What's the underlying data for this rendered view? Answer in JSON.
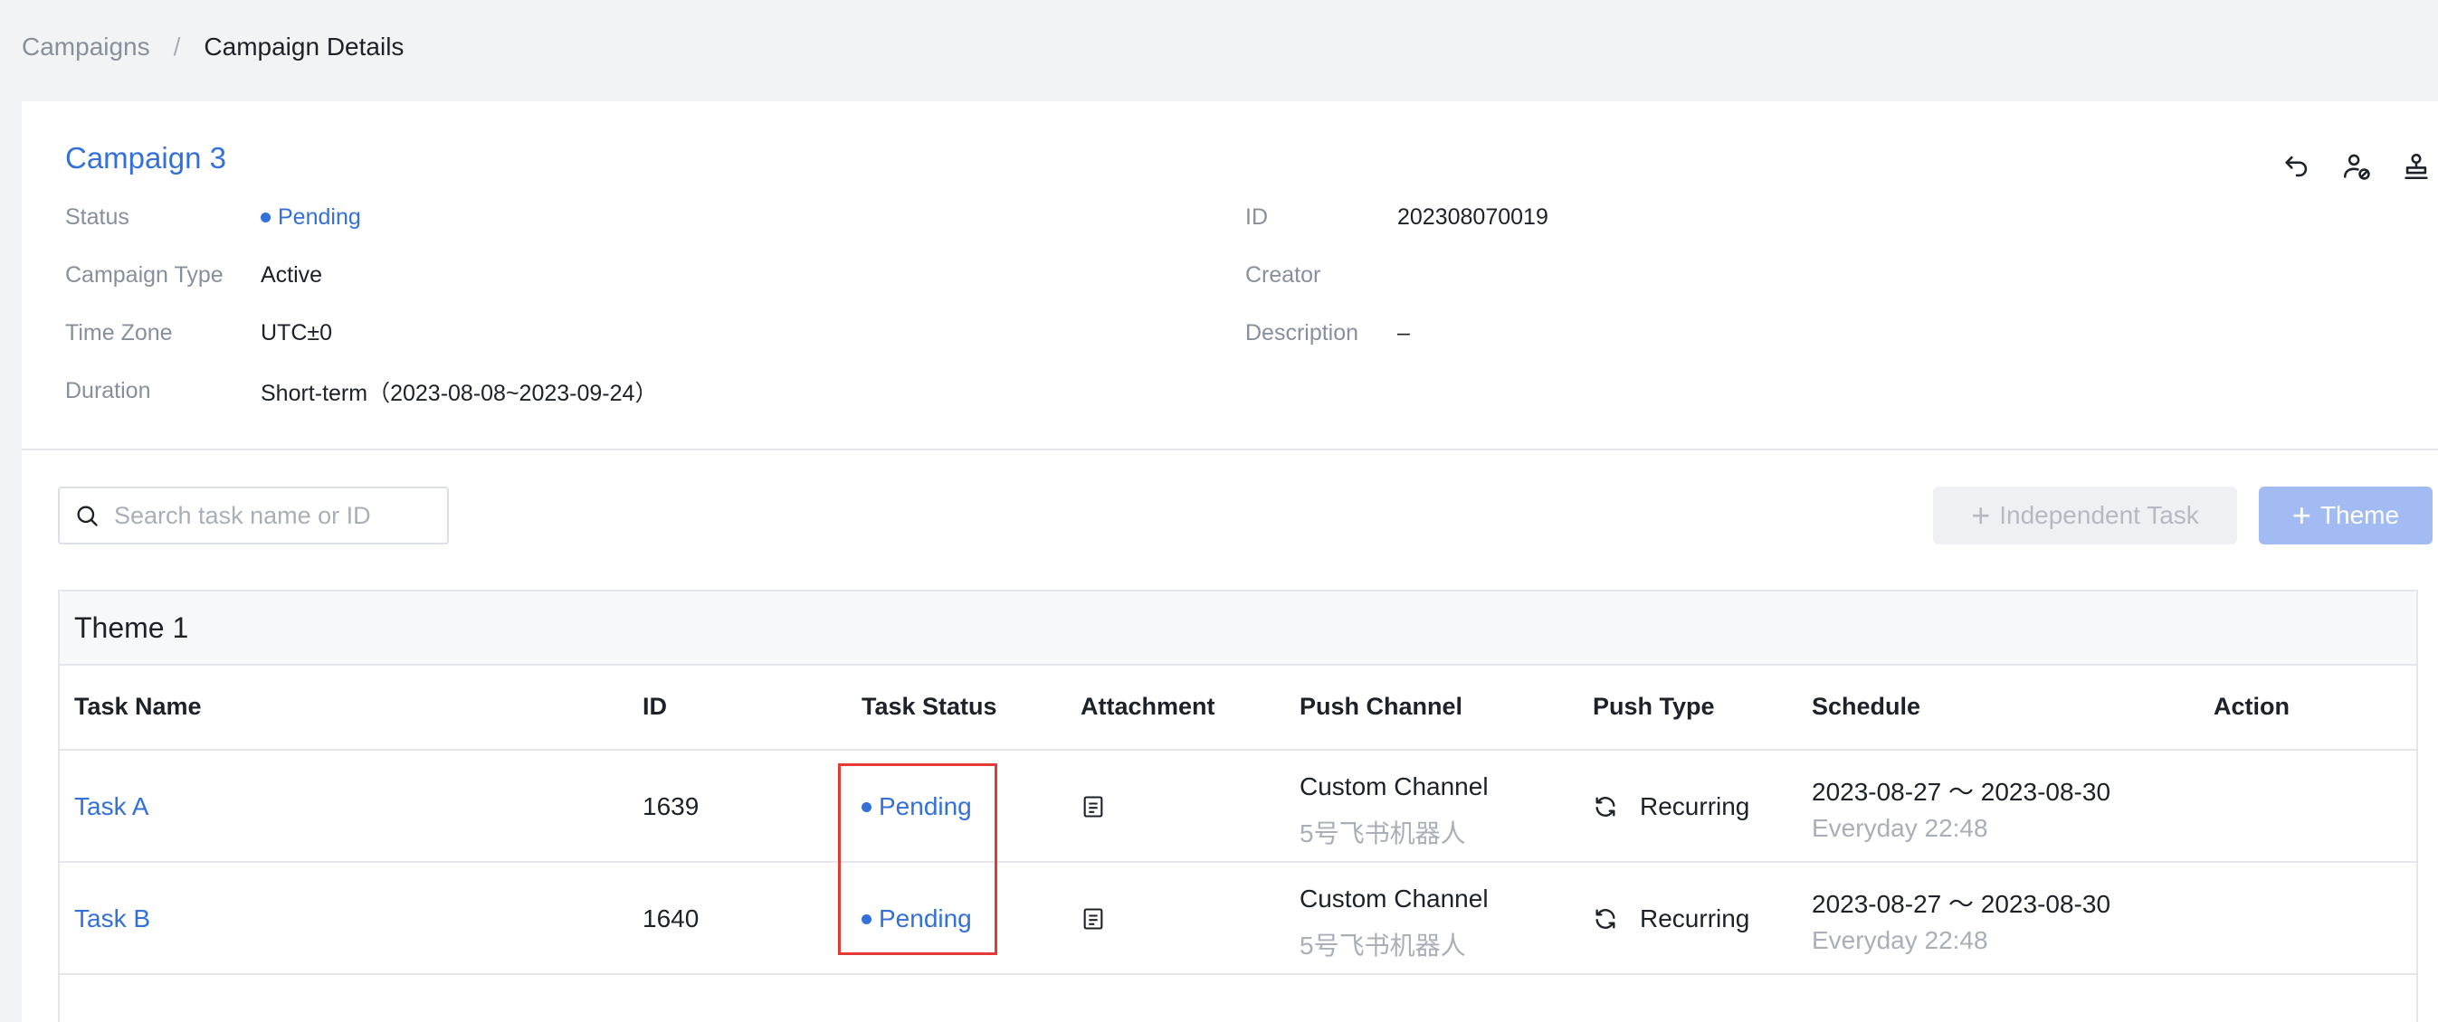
{
  "breadcrumb": {
    "parent": "Campaigns",
    "separator": "/",
    "current": "Campaign Details"
  },
  "campaign": {
    "title": "Campaign 3",
    "fields": {
      "status_label": "Status",
      "status_value": "Pending",
      "type_label": "Campaign Type",
      "type_value": "Active",
      "timezone_label": "Time Zone",
      "timezone_value": "UTC±0",
      "duration_label": "Duration",
      "duration_value": "Short-term（2023-08-08~2023-09-24）",
      "id_label": "ID",
      "id_value": "202308070019",
      "creator_label": "Creator",
      "creator_value": "",
      "description_label": "Description",
      "description_value": "–"
    },
    "actions": [
      "undo-icon",
      "user-block-icon",
      "stamp-icon"
    ]
  },
  "toolbar": {
    "search_placeholder": "Search task name or ID",
    "independent_task_label": "Independent Task",
    "theme_label": "Theme"
  },
  "theme": {
    "name": "Theme 1",
    "columns": {
      "task_name": "Task Name",
      "id": "ID",
      "task_status": "Task Status",
      "attachment": "Attachment",
      "push_channel": "Push Channel",
      "push_type": "Push Type",
      "schedule": "Schedule",
      "action": "Action"
    },
    "rows": [
      {
        "task_name": "Task A",
        "id": "1639",
        "status": "Pending",
        "channel": "Custom Channel",
        "channel_sub": "5号飞书机器人",
        "push_type": "Recurring",
        "schedule": "2023-08-27 ～ 2023-08-30",
        "schedule_sub": "Everyday 22:48"
      },
      {
        "task_name": "Task B",
        "id": "1640",
        "status": "Pending",
        "channel": "Custom Channel",
        "channel_sub": "5号飞书机器人",
        "push_type": "Recurring",
        "schedule": "2023-08-27 ～ 2023-08-30",
        "schedule_sub": "Everyday 22:48"
      }
    ]
  },
  "colors": {
    "accent": "#3370d8",
    "highlight": "#e53935",
    "theme_button": "#a3bbf3"
  }
}
